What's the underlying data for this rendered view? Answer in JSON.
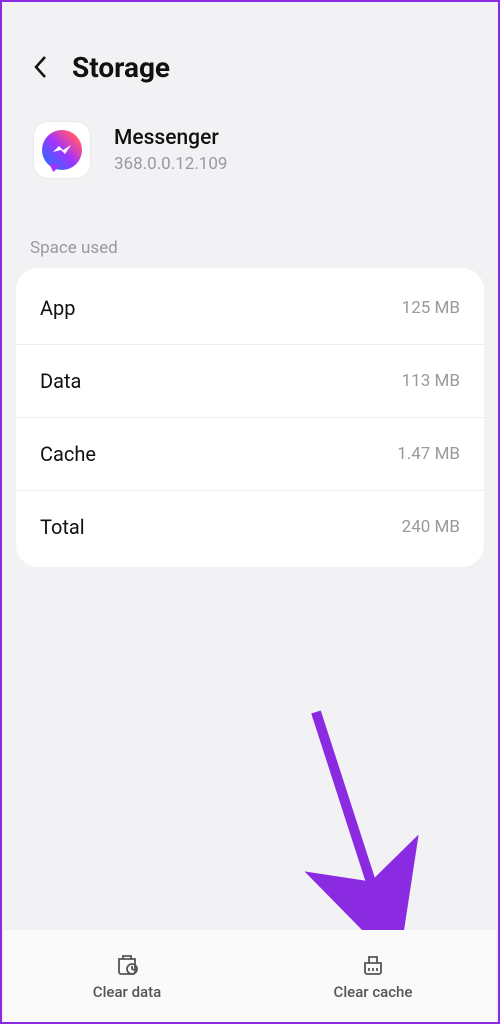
{
  "header": {
    "title": "Storage"
  },
  "app": {
    "name": "Messenger",
    "version": "368.0.0.12.109"
  },
  "section_label": "Space used",
  "rows": [
    {
      "label": "App",
      "value": "125 MB"
    },
    {
      "label": "Data",
      "value": "113 MB"
    },
    {
      "label": "Cache",
      "value": "1.47 MB"
    },
    {
      "label": "Total",
      "value": "240 MB"
    }
  ],
  "buttons": {
    "clear_data": "Clear data",
    "clear_cache": "Clear cache"
  }
}
